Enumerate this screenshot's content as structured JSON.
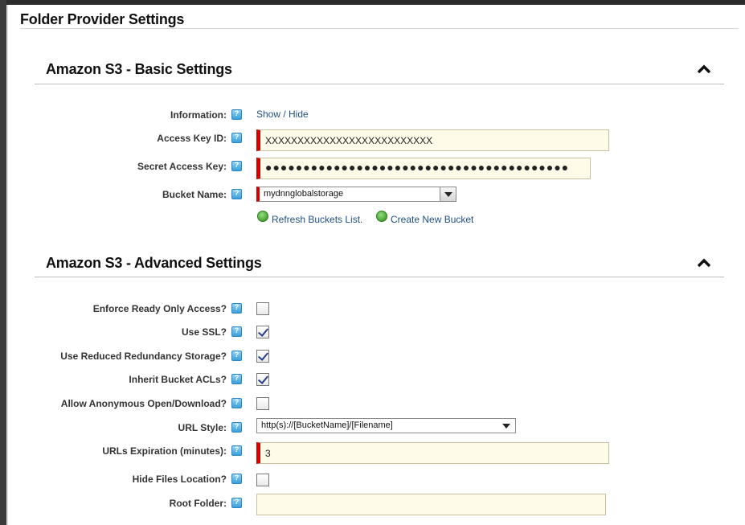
{
  "page_title": "Folder Provider Settings",
  "basic": {
    "heading": "Amazon S3 - Basic Settings",
    "information_label": "Information:",
    "information_link": "Show / Hide",
    "access_key_label": "Access Key ID:",
    "access_key_value": "XXXXXXXXXXXXXXXXXXXXXXXXXX",
    "secret_key_label": "Secret Access Key:",
    "secret_key_value": "●●●●●●●●●●●●●●●●●●●●●●●●●●●●●●●●●●●●●●●●",
    "bucket_label": "Bucket Name:",
    "bucket_value": "mydnnglobalstorage",
    "refresh_link": "Refresh Buckets List.",
    "create_link": "Create New Bucket"
  },
  "advanced": {
    "heading": "Amazon S3 - Advanced Settings",
    "enforce_label": "Enforce Ready Only Access?",
    "ssl_label": "Use SSL?",
    "reduced_label": "Use Reduced Redundancy Storage?",
    "inherit_label": "Inherit Bucket ACLs?",
    "anonymous_label": "Allow Anonymous Open/Download?",
    "url_style_label": "URL Style:",
    "url_style_value": "http(s)://[BucketName]/[Filename]",
    "expiration_label": "URLs Expiration (minutes):",
    "expiration_value": "3",
    "hide_label": "Hide Files Location?",
    "root_label": "Root Folder:",
    "root_value": ""
  },
  "checkboxes": {
    "enforce": false,
    "ssl": true,
    "reduced": true,
    "inherit": true,
    "anonymous": false,
    "hide": false
  },
  "colors": {
    "required_marker": "#d40000",
    "input_background": "#fffbe9",
    "link": "#1f4f84",
    "help_icon": "#3aa0dc"
  }
}
